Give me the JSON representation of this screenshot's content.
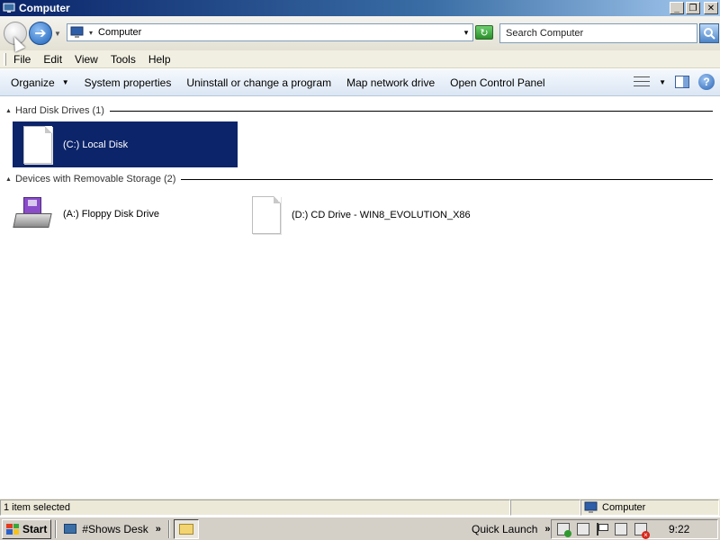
{
  "window": {
    "title": "Computer",
    "controls": {
      "minimize": "_",
      "maximize": "❐",
      "close": "✕"
    }
  },
  "navigation": {
    "back_icon": "back-arrow-icon",
    "forward_glyph": "➔",
    "address_separator": "▾",
    "address_text": "Computer",
    "address_dropdown": "▾",
    "refresh_glyph": "↻",
    "search_placeholder": "Search Computer"
  },
  "menu": {
    "items": [
      "File",
      "Edit",
      "View",
      "Tools",
      "Help"
    ]
  },
  "commandbar": {
    "organize": "Organize",
    "caret": "▼",
    "items": [
      "System properties",
      "Uninstall or change a program",
      "Map network drive",
      "Open Control Panel"
    ],
    "help": "?"
  },
  "content": {
    "groups": [
      {
        "header": "Hard Disk Drives (1)",
        "items": [
          {
            "label": "(C:) Local Disk",
            "selected": true,
            "icon": "drive-doc-icon"
          }
        ]
      },
      {
        "header": "Devices with Removable Storage (2)",
        "items": [
          {
            "label": "(A:) Floppy Disk Drive",
            "selected": false,
            "icon": "floppy-drive-icon"
          },
          {
            "label": "(D:) CD Drive - WIN8_EVOLUTION_X86",
            "selected": false,
            "icon": "cd-drive-doc-icon"
          }
        ]
      }
    ],
    "group_toggle": "▲"
  },
  "statusbar": {
    "left": "1 item selected",
    "right": "Computer"
  },
  "taskbar": {
    "start": "Start",
    "task_label": "#Shows Desk",
    "chevron": "»",
    "quick_launch": "Quick Launch",
    "clock": "9:22"
  },
  "colors": {
    "selection": "#0c246a",
    "titlebar": "#0a246a",
    "header_text": "#1e3287"
  }
}
